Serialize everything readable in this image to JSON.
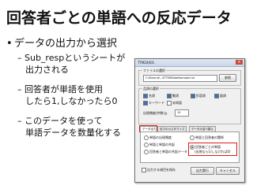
{
  "slide": {
    "title": "回答者ごとの単語への反応データ",
    "bullet1": "データの出力から選択",
    "sub1_line1": "– Sub_respというシートが",
    "sub1_line2": "出力される",
    "sub2_line1": "– 回答者が単語を使用",
    "sub2_line2": "したら1,しなかったら0",
    "sub3_line1": "– このデータを使って",
    "sub3_line2": "単語データを数量化する"
  },
  "dialog": {
    "title": "TTMZ4001",
    "file_group_label": "ファイルの選択",
    "file_path": "C:¥Users¥...¥TTM¥Data¥sample.txt",
    "browse_label": "参照",
    "morph_group_label": "品詞の選択",
    "pos_options": [
      "名詞",
      "動詞",
      "形容詞",
      "副詞",
      "キーワード",
      "未知語"
    ],
    "count_label": "出現頻度(件数)≧",
    "count_value": "10",
    "tabs": [
      "データ出力",
      "出力のカスタマイズ",
      "データの並べ替え"
    ],
    "panel_items": [
      "単語の出現頻度",
      "単語と単語の共起",
      "回答者と単語の共起データ"
    ],
    "right_items": [
      "単語と回答者の関係",
      "回答者ごとの単語",
      "(出現なら1/しなければ0)"
    ],
    "ok_label": "出力実行",
    "cancel_label": "キャンセル",
    "bottom_check": "出力する項目を保存"
  }
}
